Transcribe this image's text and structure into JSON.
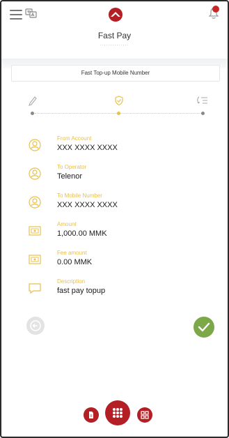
{
  "header": {
    "app_title": "Fast Pay",
    "title_dots": "..............",
    "notification_count": 1,
    "brand_color": "#b31f24"
  },
  "section": {
    "title": "Fast Top-up Mobile Number"
  },
  "steps": {
    "current_step": 2,
    "total_steps": 3,
    "icons": [
      "edit-icon",
      "shield-check-icon",
      "list-return-icon"
    ],
    "active_color": "#e8c04a"
  },
  "details": [
    {
      "label": "From Account",
      "value": "XXX XXXX XXXX",
      "icon": "user-circle-icon"
    },
    {
      "label": "To Operator",
      "value": "Telenor",
      "icon": "user-circle-icon"
    },
    {
      "label": "To Mobile Number",
      "value": "XXX XXXX XXXX",
      "icon": "user-circle-icon"
    },
    {
      "label": "Amount",
      "value": "1,000.00 MMK",
      "icon": "banknote-icon"
    },
    {
      "label": "Fee amount",
      "value": "0.00 MMK",
      "icon": "banknote-icon"
    },
    {
      "label": "Description",
      "value": "fast pay topup",
      "icon": "comment-icon"
    }
  ],
  "actions": {
    "back_icon": "arrow-left-icon",
    "confirm_icon": "checkmark-icon",
    "confirm_color": "#7da84a"
  },
  "bottom_nav": {
    "left_icon": "document-icon",
    "center_icon": "grid-menu-icon",
    "right_icon": "qr-code-icon"
  }
}
